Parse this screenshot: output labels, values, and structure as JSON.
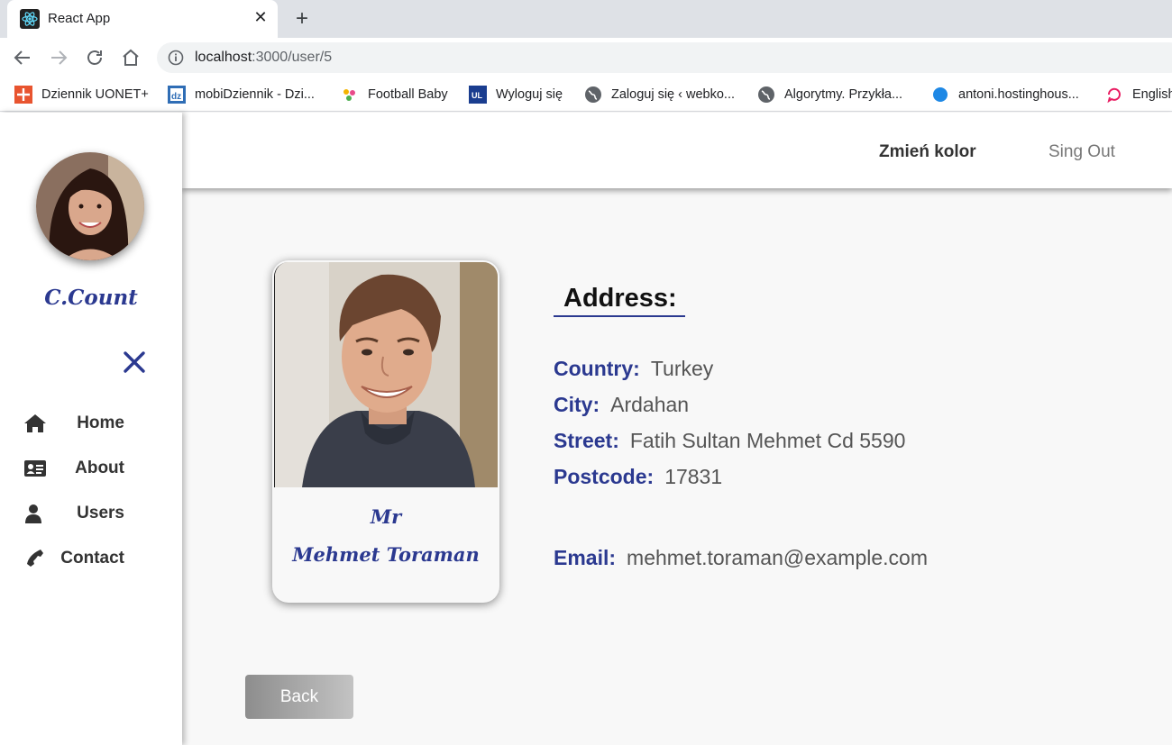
{
  "browser": {
    "tab_title": "React App",
    "url_host": "localhost",
    "url_path": ":3000/user/5",
    "bookmarks": [
      {
        "label": "Dziennik UONET+",
        "icon": "uonet-icon"
      },
      {
        "label": "mobiDziennik - Dzi...",
        "icon": "mobidziennik-icon"
      },
      {
        "label": "Football Baby",
        "icon": "football-baby-icon"
      },
      {
        "label": "Wyloguj się",
        "icon": "ul-icon"
      },
      {
        "label": "Zaloguj się ‹ webko...",
        "icon": "globe-icon"
      },
      {
        "label": "Algorytmy. Przykła...",
        "icon": "globe-icon"
      },
      {
        "label": "antoni.hostinghous...",
        "icon": "blue-dot-icon"
      },
      {
        "label": "English",
        "icon": "english-icon"
      }
    ]
  },
  "sidebar": {
    "brand": "C.Count",
    "menu": [
      {
        "label": "Home",
        "icon": "home-icon"
      },
      {
        "label": "About",
        "icon": "id-card-icon"
      },
      {
        "label": "Users",
        "icon": "user-icon"
      },
      {
        "label": "Contact",
        "icon": "phone-icon"
      }
    ]
  },
  "topbar": {
    "change_color": "Zmień kolor",
    "sign_out": "Sing Out"
  },
  "user": {
    "title": "Mr",
    "name": "Mehmet Toraman",
    "address_heading": "Address:",
    "country_label": "Country:",
    "country": "Turkey",
    "city_label": "City:",
    "city": "Ardahan",
    "street_label": "Street:",
    "street": "Fatih Sultan Mehmet Cd 5590",
    "postcode_label": "Postcode:",
    "postcode": "17831",
    "email_label": "Email:",
    "email": "mehmet.toraman@example.com"
  },
  "back_label": "Back",
  "colors": {
    "accent": "#2b3990",
    "text_dark": "#333333",
    "content_bg": "#f8f8f8"
  }
}
